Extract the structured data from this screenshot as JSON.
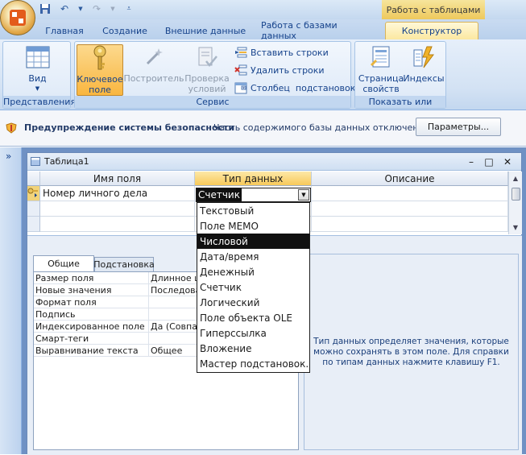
{
  "contextual_tab_title": "Работа с таблицами",
  "tabs": [
    "Главная",
    "Создание",
    "Внешние данные",
    "Работа с базами данных",
    "Конструктор"
  ],
  "ribbon": {
    "groups": [
      {
        "label": "Представления",
        "view_label": "Вид"
      },
      {
        "label": "Сервис",
        "key_field": "Ключевое\nполе",
        "builder": "Построитель",
        "check": "Проверка\nусловий",
        "insert_rows": "Вставить строки",
        "delete_rows": "Удалить строки",
        "lookup_column": "Столбец  подстановок"
      },
      {
        "label": "Показать или скрыть",
        "property_sheet": "Страница\nсвойств",
        "indexes": "Индексы"
      }
    ]
  },
  "security": {
    "title": "Предупреждение системы безопасности",
    "message": "Часть содержимого базы данных отключено",
    "button": "Параметры..."
  },
  "nav_toggle": "»",
  "document": {
    "title": "Таблица1",
    "minimize": "–",
    "restore": "□",
    "close": "✕"
  },
  "grid": {
    "headers": [
      "Имя поля",
      "Тип данных",
      "Описание"
    ],
    "row1": {
      "field_name": "Номер личного дела",
      "data_type": "Счетчик"
    }
  },
  "dropdown_options": [
    "Текстовый",
    "Поле MEMO",
    "Числовой",
    "Дата/время",
    "Денежный",
    "Счетчик",
    "Логический",
    "Поле объекта OLE",
    "Гиперссылка",
    "Вложение",
    "Мастер подстановок."
  ],
  "dropdown_selected": "Числовой",
  "properties": {
    "tabs": [
      "Общие",
      "Подстановка"
    ],
    "rows": [
      {
        "label": "Размер поля",
        "value": "Длинное ц"
      },
      {
        "label": "Новые значения",
        "value": "Последова"
      },
      {
        "label": "Формат поля",
        "value": ""
      },
      {
        "label": "Подпись",
        "value": ""
      },
      {
        "label": "Индексированное поле",
        "value": "Да (Совпад"
      },
      {
        "label": "Смарт-теги",
        "value": ""
      },
      {
        "label": "Выравнивание текста",
        "value": "Общее"
      }
    ],
    "help": "Тип данных определяет значения, которые можно сохранять в этом поле.  Для справки по типам данных нажмите клавишу F1."
  }
}
